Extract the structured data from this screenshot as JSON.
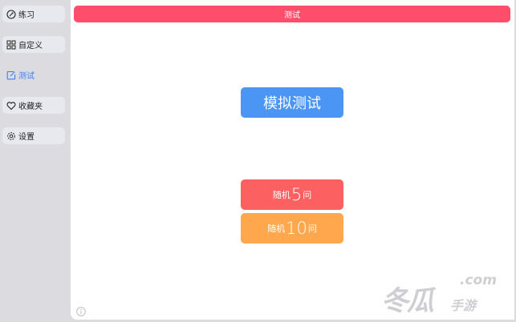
{
  "sidebar": {
    "items": [
      {
        "label": "练习",
        "icon": "compass-icon"
      },
      {
        "label": "自定义",
        "icon": "grid-icon"
      },
      {
        "label": "测试",
        "icon": "edit-icon"
      },
      {
        "label": "收藏夹",
        "icon": "heart-icon"
      },
      {
        "label": "设置",
        "icon": "gear-icon"
      }
    ]
  },
  "header": {
    "title": "测试"
  },
  "main": {
    "sim_test_label": "模拟测试",
    "random5": {
      "prefix": "随机",
      "number": "5",
      "suffix": "问"
    },
    "random10": {
      "prefix": "随机",
      "number": "10",
      "suffix": "问"
    }
  },
  "watermark": {
    "brand": "冬瓜",
    "sub": "手游",
    "domain": ".com"
  },
  "colors": {
    "topbar": "#ff4e6c",
    "sim_button": "#4b96f5",
    "random5_button": "#fd6060",
    "random10_button": "#ffa74d",
    "active_nav": "#3b7ef5"
  }
}
